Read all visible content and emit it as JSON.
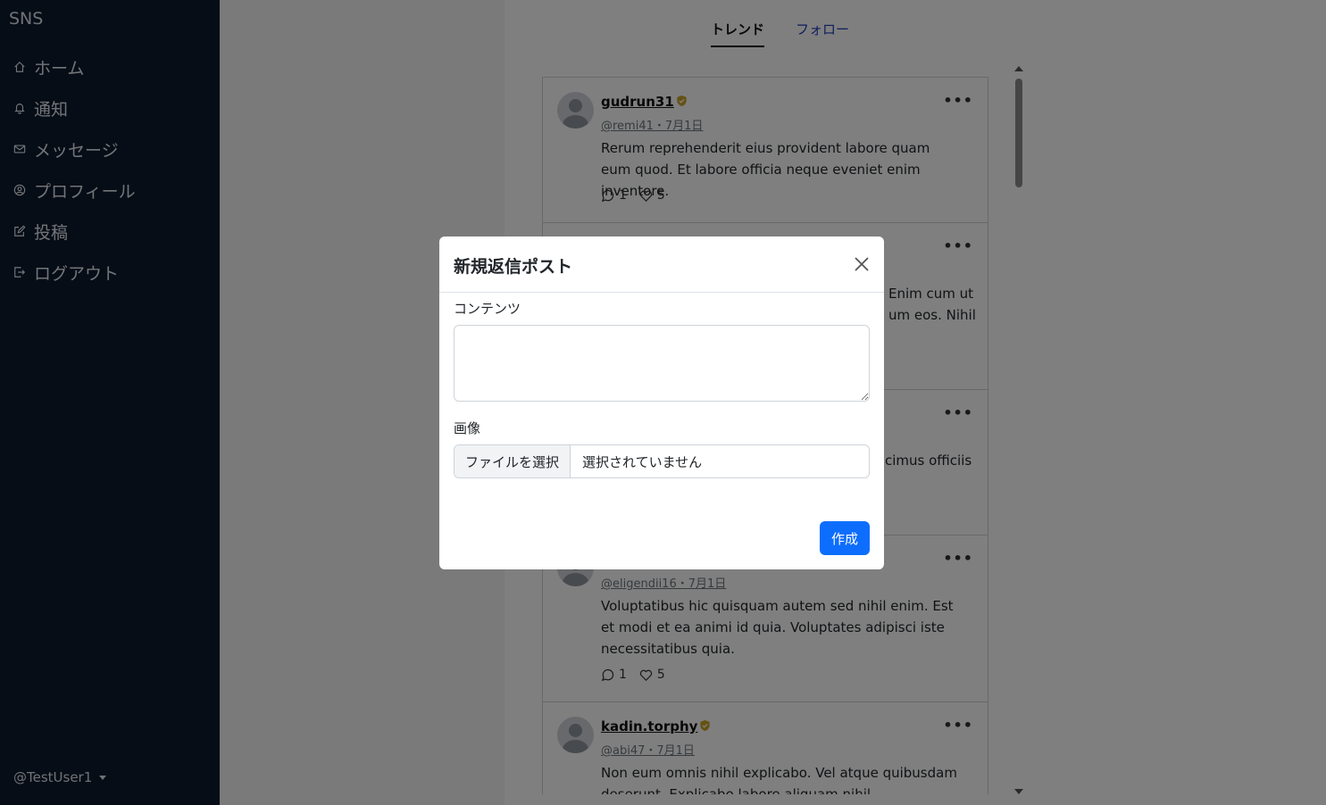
{
  "sidebar": {
    "brand": "SNS",
    "items": [
      {
        "label": "ホーム",
        "icon": "home-icon"
      },
      {
        "label": "通知",
        "icon": "bell-icon"
      },
      {
        "label": "メッセージ",
        "icon": "envelope-icon"
      },
      {
        "label": "プロフィール",
        "icon": "person-circle-icon"
      },
      {
        "label": "投稿",
        "icon": "pencil-square-icon"
      },
      {
        "label": "ログアウト",
        "icon": "logout-icon"
      }
    ],
    "user": "@TestUser1"
  },
  "tabs": [
    {
      "label": "トレンド",
      "active": true
    },
    {
      "label": "フォロー",
      "active": false
    }
  ],
  "posts": [
    {
      "username": "gudrun31",
      "verified": true,
      "handle_date": "@remi41・7月1日",
      "content": "Rerum reprehenderit eius provident labore quam eum quod. Et labore officia neque eveniet enim inventore.",
      "replies": "1",
      "likes": "5"
    },
    {
      "username": "",
      "verified": false,
      "handle_date": "",
      "content": "Enim cum ut / um eos. Nihil",
      "replies": "",
      "likes": ""
    },
    {
      "username": "",
      "verified": false,
      "handle_date": "",
      "content": "cimus officiis",
      "replies": "",
      "likes": ""
    },
    {
      "username": "",
      "verified": false,
      "handle_date": "@eligendii16・7月1日",
      "content": "Voluptatibus hic quisquam autem sed nihil enim. Est et modi et ea animi id quia. Voluptates adipisci iste necessitatibus quia.",
      "replies": "1",
      "likes": "5"
    },
    {
      "username": "kadin.torphy",
      "verified": true,
      "handle_date": "@abi47・7月1日",
      "content": "Non eum omnis nihil explicabo. Vel atque quibusdam deserunt. Explicabo labore aliquam nihil",
      "replies": "",
      "likes": ""
    }
  ],
  "partial_texts": {
    "p2_line1": "Enim cum ut",
    "p2_line2": "um eos. Nihil",
    "p3_line1": "cimus officiis"
  },
  "modal": {
    "title": "新規返信ポスト",
    "content_label": "コンテンツ",
    "content_value": "",
    "image_label": "画像",
    "file_button": "ファイルを選択",
    "file_status": "選択されていません",
    "submit": "作成"
  },
  "colors": {
    "sidebar_bg": "#0d1b2e",
    "primary": "#0d6efd",
    "verified": "#c9a227",
    "follow_tab": "#1c3ab8"
  }
}
